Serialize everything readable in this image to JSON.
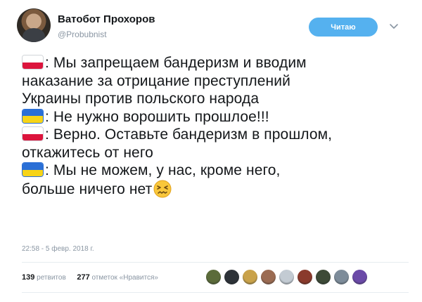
{
  "user": {
    "name": "Ватобот Прохоров",
    "handle": "@Probubnist"
  },
  "follow_button": {
    "label": "Читаю"
  },
  "tweet": {
    "lines": [
      {
        "flag": "poland-flag",
        "text": ": Мы запрещаем бандеризм и вводим"
      },
      {
        "flag": null,
        "text": "наказание за отрицание преступлений"
      },
      {
        "flag": null,
        "text": "Украины против польского народа"
      },
      {
        "flag": "ukraine-flag",
        "text": ": Не нужно ворошить прошлое!!!"
      },
      {
        "flag": "poland-flag",
        "text": ": Верно. Оставьте бандеризм в прошлом,"
      },
      {
        "flag": null,
        "text": "откажитесь от него"
      },
      {
        "flag": "ukraine-flag",
        "text": ": Мы не можем, у нас, кроме него,"
      },
      {
        "flag": null,
        "text": "больше ничего нет",
        "trailing_emoji": "confounded-face-emoji"
      }
    ],
    "timestamp": "22:58 - 5 февр. 2018 г."
  },
  "stats": {
    "retweets_count": "139",
    "retweets_label": "ретвитов",
    "likes_count": "277",
    "likes_label": "отметок «Нравится»"
  },
  "likers": [
    {
      "icon": "liker-avatar",
      "color": "#5b6b3a"
    },
    {
      "icon": "liker-avatar",
      "color": "#2d3238"
    },
    {
      "icon": "liker-avatar",
      "color": "#c9a24a"
    },
    {
      "icon": "liker-avatar",
      "color": "#9b6b52"
    },
    {
      "icon": "liker-avatar",
      "color": "#c3cbd3"
    },
    {
      "icon": "liker-avatar",
      "color": "#8a3a2c"
    },
    {
      "icon": "liker-avatar",
      "color": "#3d4a37"
    },
    {
      "icon": "liker-avatar",
      "color": "#7d8c9a"
    },
    {
      "icon": "liker-avatar",
      "color": "#6b4aa8"
    }
  ],
  "colors": {
    "accent": "#55b1ef",
    "secondary_text": "#8a96a3",
    "primary_text": "#14171a",
    "divider": "#e6ecf0"
  }
}
